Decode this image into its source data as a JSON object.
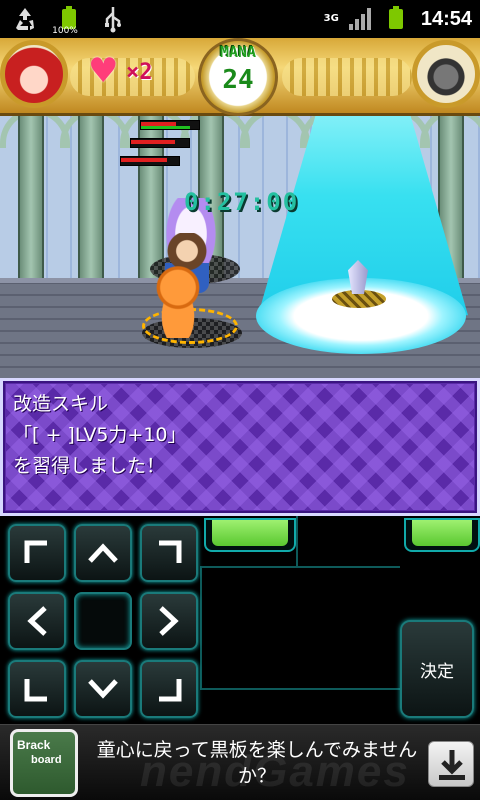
{
  "status_bar": {
    "battery_percent": "100%",
    "network": "3G",
    "time": "14:54"
  },
  "hud": {
    "lives": "×2",
    "mana_label": "MANA",
    "mana_value": "24"
  },
  "scene": {
    "timer": "0:27:00"
  },
  "dialog": {
    "lines": [
      "改造スキル",
      "「[ + ]LV5力+10」",
      "を習得しました！"
    ]
  },
  "controls": {
    "decide_label": "決定"
  },
  "ad": {
    "logo_line1": "Brack",
    "logo_line2": "board",
    "text": "童心に戻って黒板を楽しんでみませんか？",
    "watermark": "nendGames"
  },
  "colors": {
    "dialog_bg": "#5a2aa8",
    "light_beam": "#38e0f0",
    "controller_glow": "#11aaaa"
  }
}
